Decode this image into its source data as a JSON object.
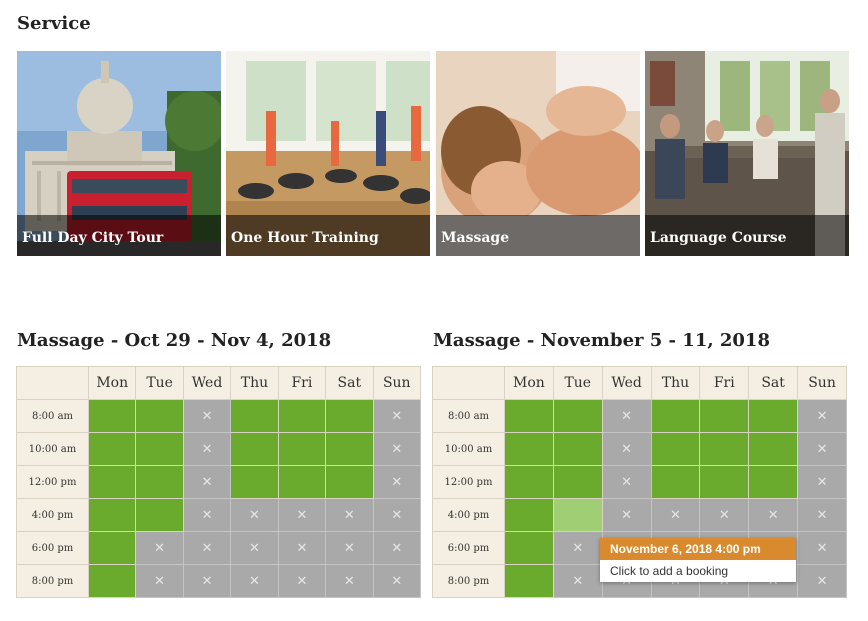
{
  "section_title": "Service",
  "tiles": [
    {
      "caption": "Full Day City Tour"
    },
    {
      "caption": "One Hour Training"
    },
    {
      "caption": "Massage"
    },
    {
      "caption": "Language Course"
    }
  ],
  "calendars": [
    {
      "title": "Massage - Oct 29 - Nov 4, 2018",
      "days": [
        "Mon",
        "Tue",
        "Wed",
        "Thu",
        "Fri",
        "Sat",
        "Sun"
      ],
      "times": [
        "8:00 am",
        "10:00 am",
        "12:00 pm",
        "4:00 pm",
        "6:00 pm",
        "8:00 pm"
      ],
      "slots": [
        [
          "a",
          "a",
          "x",
          "a",
          "a",
          "a",
          "x"
        ],
        [
          "a",
          "a",
          "x",
          "a",
          "a",
          "a",
          "x"
        ],
        [
          "a",
          "a",
          "x",
          "a",
          "a",
          "a",
          "x"
        ],
        [
          "a",
          "a",
          "x",
          "x",
          "x",
          "x",
          "x"
        ],
        [
          "a",
          "x",
          "x",
          "x",
          "x",
          "x",
          "x"
        ],
        [
          "a",
          "x",
          "x",
          "x",
          "x",
          "x",
          "x"
        ]
      ]
    },
    {
      "title": "Massage - November 5 - 11, 2018",
      "days": [
        "Mon",
        "Tue",
        "Wed",
        "Thu",
        "Fri",
        "Sat",
        "Sun"
      ],
      "times": [
        "8:00 am",
        "10:00 am",
        "12:00 pm",
        "4:00 pm",
        "6:00 pm",
        "8:00 pm"
      ],
      "slots": [
        [
          "a",
          "a",
          "x",
          "a",
          "a",
          "a",
          "x"
        ],
        [
          "a",
          "a",
          "x",
          "a",
          "a",
          "a",
          "x"
        ],
        [
          "a",
          "a",
          "x",
          "a",
          "a",
          "a",
          "x"
        ],
        [
          "a",
          "h",
          "x",
          "x",
          "x",
          "x",
          "x"
        ],
        [
          "a",
          "x",
          "x",
          "x",
          "x",
          "x",
          "x"
        ],
        [
          "a",
          "x",
          "x",
          "x",
          "x",
          "x",
          "x"
        ]
      ]
    }
  ],
  "unavailable_mark": "✕",
  "tooltip": {
    "title": "November 6, 2018 4:00 pm",
    "text": "Click to add a booking"
  },
  "colors": {
    "available": "#6aaa2c",
    "available_hover": "#9fce74",
    "unavailable": "#a9a9a9",
    "header_bg": "#f4efe2",
    "tooltip_accent": "#d98a2e"
  }
}
